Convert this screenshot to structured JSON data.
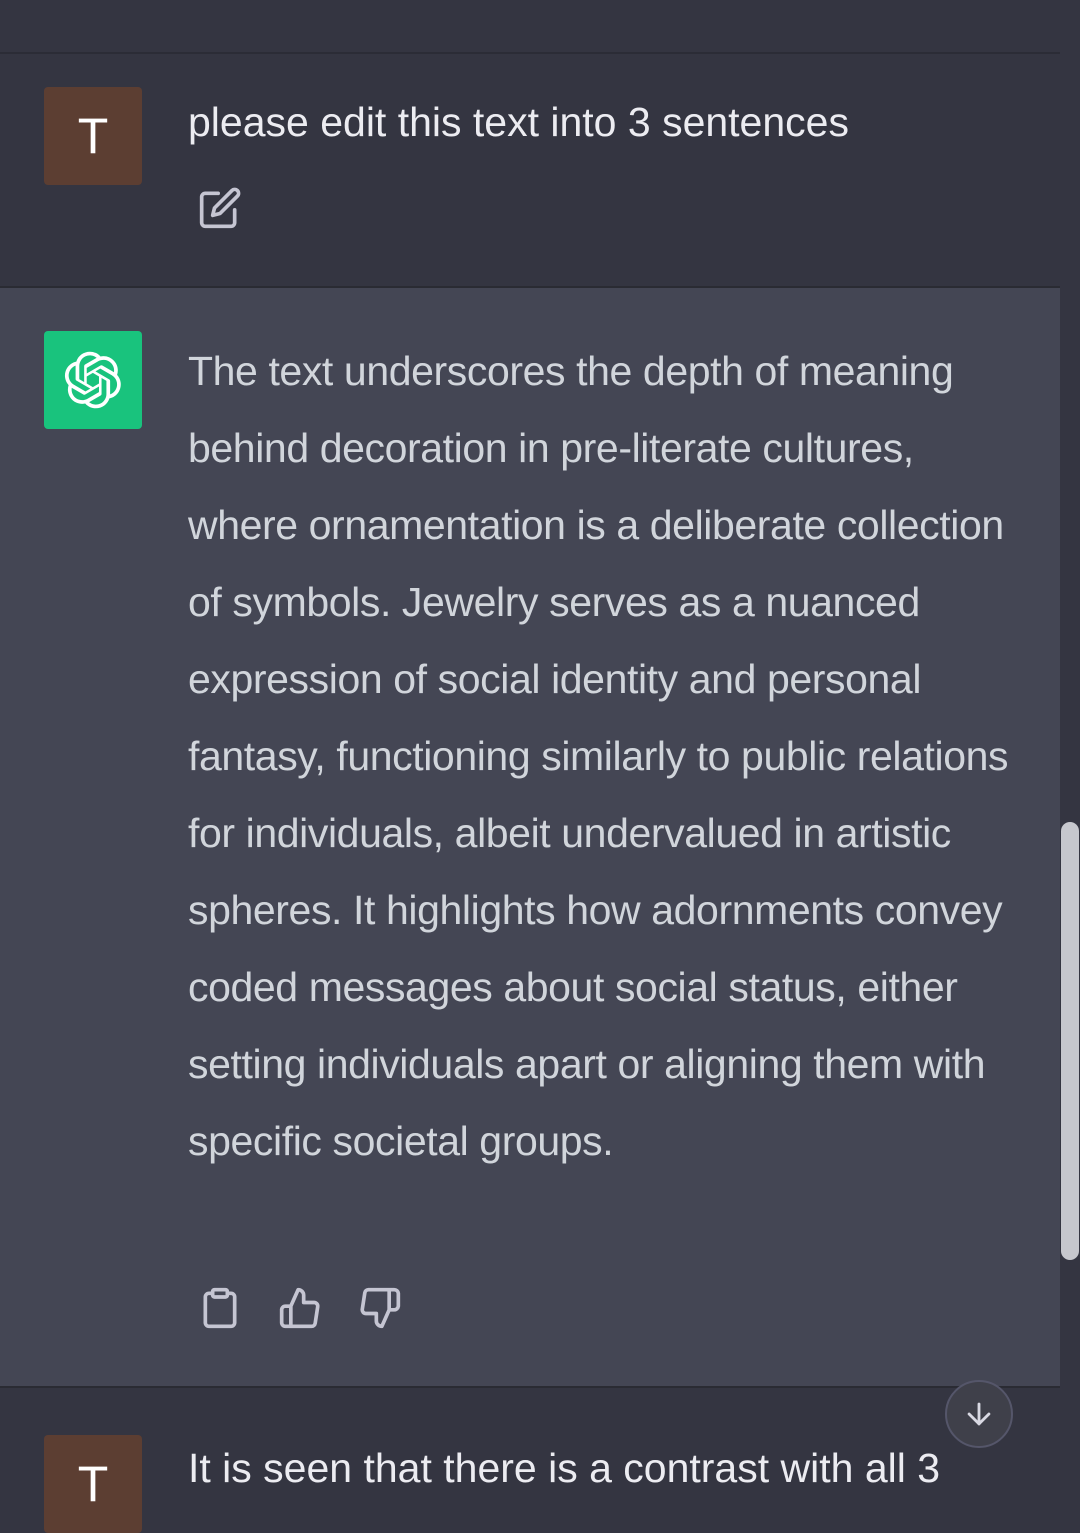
{
  "conversation": {
    "user_message_1": {
      "avatar_letter": "T",
      "text": "please edit this text into 3 sentences"
    },
    "assistant_message": {
      "text": "The text underscores the depth of meaning behind decoration in pre-literate cultures, where ornamentation is a deliberate collection of symbols. Jewelry serves as a nuanced expression of social identity and personal fantasy, functioning similarly to public relations for individuals, albeit undervalued in artistic spheres. It highlights how adornments convey coded messages about social status, either setting individuals apart or aligning them with specific societal groups."
    },
    "user_message_2": {
      "avatar_letter": "T",
      "text": "It is seen that there is a contrast with all 3"
    }
  },
  "icons": {
    "edit": "edit-icon",
    "copy": "clipboard-icon",
    "like": "thumbs-up-icon",
    "dislike": "thumbs-down-icon",
    "scroll_down": "arrow-down-icon",
    "assistant_logo": "openai-logo-icon"
  },
  "colors": {
    "background": "#343541",
    "assistant_background": "#444654",
    "user_avatar": "#5c3e32",
    "assistant_avatar": "#19c37d",
    "text_primary": "#ececf1",
    "text_secondary": "#d1d5db"
  }
}
